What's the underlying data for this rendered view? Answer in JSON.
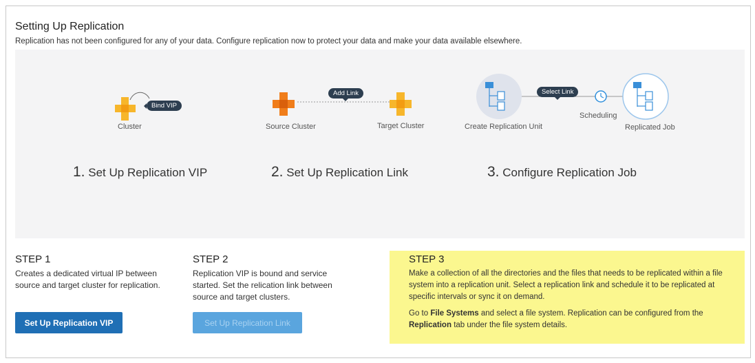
{
  "header": {
    "title": "Setting Up Replication",
    "subtitle": "Replication has not been configured for any of your data. Configure replication now to protect your data and make your data available elsewhere."
  },
  "diagram": {
    "step1": {
      "node_label": "Cluster",
      "pill": "Bind VIP",
      "num": "1.",
      "heading": "Set Up Replication VIP"
    },
    "step2": {
      "source_label": "Source Cluster",
      "target_label": "Target Cluster",
      "pill": "Add Link",
      "num": "2.",
      "heading": "Set Up Replication Link"
    },
    "step3": {
      "unit_label": "Create Replication Unit",
      "scheduling_label": "Scheduling",
      "job_label": "Replicated Job",
      "pill": "Select Link",
      "num": "3.",
      "heading": "Configure Replication Job"
    },
    "colors": {
      "orange": "#f07d1a",
      "yellow": "#f7b62b",
      "pill": "#2d3e50",
      "blue": "#2f8fdc"
    }
  },
  "steps": {
    "step1": {
      "title": "STEP 1",
      "desc": "Creates a dedicated virtual IP between source and target cluster for replication.",
      "button": "Set Up Replication VIP"
    },
    "step2": {
      "title": "STEP 2",
      "desc": "Replication VIP is bound and service started. Set the relication link between source and target clusters.",
      "button": "Set Up Replication Link"
    },
    "step3": {
      "title": "STEP 3",
      "desc": "Make a collection of all the directories and the files that needs to be replicated within a file system into a replication unit. Select a replication link and schedule it to be replicated at specific intervals or sync it on demand.",
      "go_to": "Go to",
      "file_systems": "File Systems",
      "and_select": "and select a file system. Replication can be configured from the",
      "replication_tab": "Replication",
      "tab_suffix": "tab under the file system details.",
      "highlight_color": "#fbf78f"
    }
  }
}
